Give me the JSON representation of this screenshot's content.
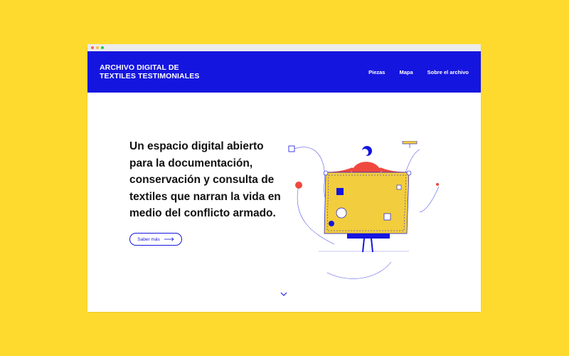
{
  "window": {
    "controls": [
      "close",
      "minimize",
      "maximize"
    ]
  },
  "header": {
    "logo_line1": "ARCHIVO DIGITAL DE",
    "logo_line2": "TEXTILES TESTIMONIALES",
    "nav": [
      {
        "label": "Piezas"
      },
      {
        "label": "Mapa"
      },
      {
        "label": "Sobre el archivo"
      }
    ]
  },
  "hero": {
    "headline": "Un espacio digital abierto para la documentación, conservación y consulta de textiles que narran la vida en medio del conflicto armado.",
    "cta_label": "Saber más",
    "cta_icon": "arrow-right-icon",
    "scroll_icon": "chevron-down-icon",
    "illustration": "person-holding-textile-illustration"
  },
  "colors": {
    "background": "#FFDA2E",
    "brand_blue": "#1515E0",
    "accent_red": "#F0483E",
    "textile_yellow": "#F2CD3D",
    "text": "#111111"
  }
}
